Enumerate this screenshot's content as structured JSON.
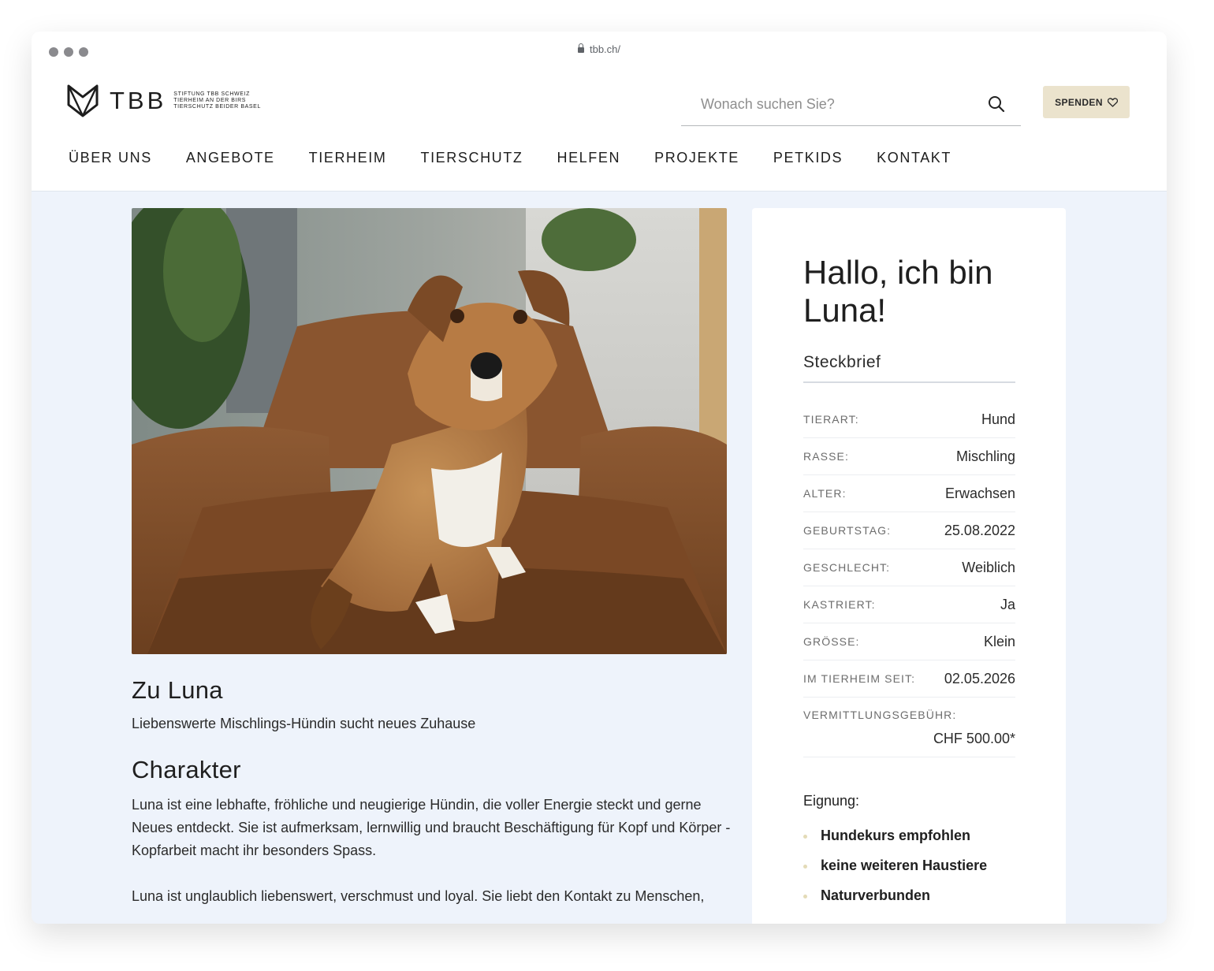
{
  "browser": {
    "url": "tbb.ch/"
  },
  "header": {
    "logo_text": "TBB",
    "logo_subtitle": [
      "STIFTUNG TBB SCHWEIZ",
      "TIERHEIM AN DER BIRS",
      "TIERSCHUTZ BEIDER BASEL"
    ],
    "search_placeholder": "Wonach suchen Sie?",
    "donate_label": "SPENDEN",
    "nav": [
      "ÜBER UNS",
      "ANGEBOTE",
      "TIERHEIM",
      "TIERSCHUTZ",
      "HELFEN",
      "PROJEKTE",
      "PETKIDS",
      "KONTAKT"
    ]
  },
  "story": {
    "about_title": "Zu Luna",
    "about_subtitle": "Liebenswerte Mischlings-Hündin sucht neues Zuhause",
    "character_title": "Charakter",
    "paragraph_1": "Luna ist eine lebhafte, fröhliche und neugierige Hündin, die voller Energie steckt und gerne Neues entdeckt. Sie ist aufmerksam, lernwillig und braucht Beschäftigung für Kopf und Körper - Kopfarbeit macht ihr besonders Spass.",
    "paragraph_2": "Luna ist unglaublich liebenswert, verschmust und loyal. Sie liebt den Kontakt zu Menschen,"
  },
  "profile": {
    "greeting": "Hallo, ich bin Luna!",
    "section_title": "Steckbrief",
    "facts": [
      {
        "label": "TIERART:",
        "value": "Hund"
      },
      {
        "label": "RASSE:",
        "value": "Mischling"
      },
      {
        "label": "ALTER:",
        "value": "Erwachsen"
      },
      {
        "label": "GEBURTSTAG:",
        "value": "25.08.2022"
      },
      {
        "label": "GESCHLECHT:",
        "value": "Weiblich"
      },
      {
        "label": "KASTRIERT:",
        "value": "Ja"
      },
      {
        "label": "GRÖSSE:",
        "value": "Klein"
      },
      {
        "label": "IM TIERHEIM SEIT:",
        "value": "02.05.2026"
      }
    ],
    "fee": {
      "label": "VERMITTLUNGSGEBÜHR:",
      "value": "CHF 500.00*"
    },
    "suitability_title": "Eignung:",
    "suitability": [
      "Hundekurs empfohlen",
      "keine weiteren Haustiere",
      "Naturverbunden"
    ]
  }
}
